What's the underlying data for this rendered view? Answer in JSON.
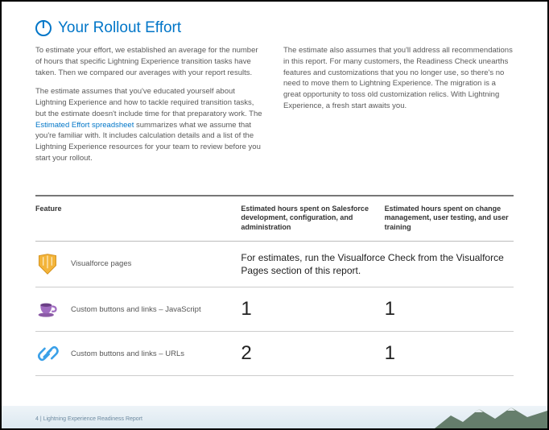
{
  "title": "Your Rollout Effort",
  "paragraphs": {
    "left1": "To estimate your effort, we established an average for the number of hours that specific Lightning Experience transition tasks have taken. Then we compared our averages with your report results.",
    "left2a": "The estimate assumes that you've educated yourself about Lightning Experience and how to tackle required transition tasks, but the estimate doesn't include time for that preparatory work. The ",
    "left2_link": "Estimated Effort spreadsheet",
    "left2b": " summarizes what we assume that you're familiar with. It includes calculation details and a list of the Lightning Experience resources for your team to review before you start your rollout.",
    "right1": "The estimate also assumes that you'll address all recommendations in this report. For many customers, the Readiness Check unearths features and customizations that you no longer use, so there's no need to move them to Lightning Experience. The migration is a great opportunity to toss old customization relics. With Lightning Experience, a fresh start awaits you."
  },
  "table": {
    "headers": {
      "feature": "Feature",
      "dev": "Estimated hours spent on Salesforce development, configuration, and administration",
      "change": "Estimated hours spent on change management, user testing, and user training"
    },
    "rows": [
      {
        "icon": "visualforce-icon",
        "feature": "Visualforce pages",
        "note": "For estimates, run the Visualforce Check from the Visualforce Pages section of this report.",
        "dev": null,
        "change": null
      },
      {
        "icon": "coffee-cup-icon",
        "feature": "Custom buttons and links – JavaScript",
        "dev": "1",
        "change": "1"
      },
      {
        "icon": "link-icon",
        "feature": "Custom buttons and links – URLs",
        "dev": "2",
        "change": "1"
      }
    ]
  },
  "footer": "4 | Lightning Experience Readiness Report"
}
